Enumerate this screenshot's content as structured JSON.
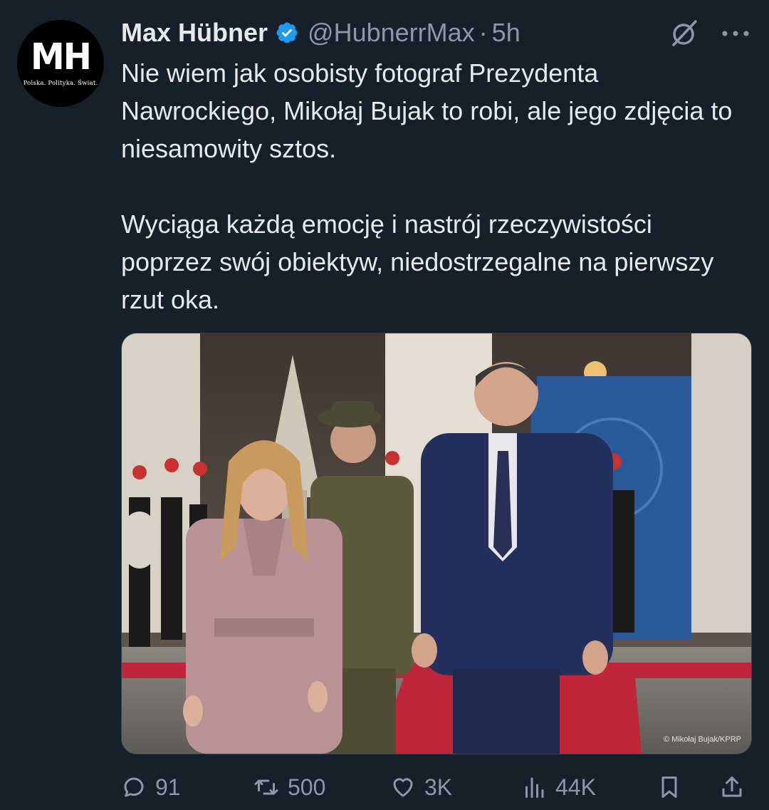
{
  "author": {
    "avatar_mono": "MH",
    "avatar_tagline": "Polska. Polityka. Świat.",
    "name": "Max Hübner",
    "handle": "@HubnerrMax",
    "separator": "·",
    "time": "5h",
    "verified": true
  },
  "tweet": {
    "paragraph_1": "Nie wiem jak osobisty fotograf Prezydenta Nawrockiego, Mikołaj Bujak to robi, ale jego zdjęcia to niesamowity sztos.",
    "paragraph_2": "Wyciąga każdą emocję i nastrój rzeczywistości poprzez swój obiektyw, niedostrzegalne na pierwszy rzut oka."
  },
  "media": {
    "credit": "© Mikołaj Bujak/KPRP"
  },
  "actions": {
    "replies": "91",
    "reposts": "500",
    "likes": "3K",
    "views": "44K"
  },
  "icons": {
    "verified": "verified-badge-icon",
    "grok": "grok-icon",
    "more": "more-icon",
    "reply": "reply-icon",
    "repost": "repost-icon",
    "like": "heart-icon",
    "views": "views-icon",
    "bookmark": "bookmark-icon",
    "share": "share-icon"
  },
  "colors": {
    "background": "#15202b",
    "text": "#e7e9ea",
    "muted": "#8b98a5",
    "verified": "#1d9bf0"
  }
}
